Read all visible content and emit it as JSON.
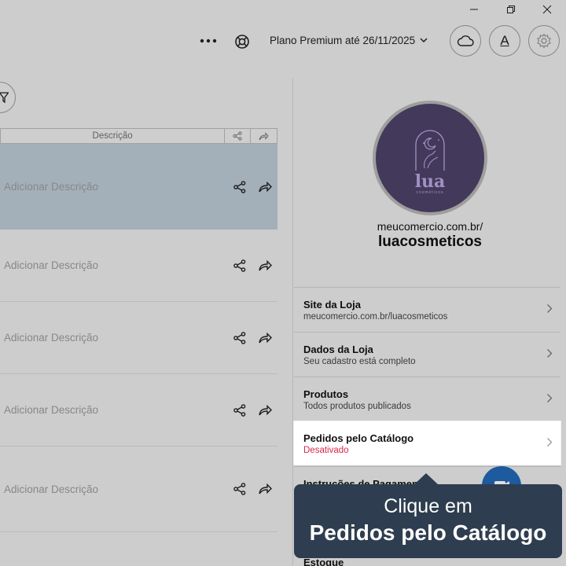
{
  "window": {
    "minimize_icon": "minimize-icon",
    "maximize_icon": "restore-icon",
    "close_icon": "close-icon"
  },
  "header": {
    "plan_label": "Plano Premium até 26/11/2025",
    "font_button_label": "A"
  },
  "table": {
    "header_description": "Descrição",
    "rows": [
      {
        "description": "Adicionar Descrição",
        "selected": true
      },
      {
        "description": "Adicionar Descrição",
        "selected": false
      },
      {
        "description": "Adicionar Descrição",
        "selected": false
      },
      {
        "description": "Adicionar Descrição",
        "selected": false
      },
      {
        "description": "Adicionar Descrição",
        "selected": false
      }
    ]
  },
  "store": {
    "logo_text": "lua",
    "logo_subtext": "cosméticos",
    "domain": "meucomercio.com.br/",
    "name": "luacosmeticos"
  },
  "menu": [
    {
      "title": "Site da Loja",
      "subtitle": "meucomercio.com.br/luacosmeticos"
    },
    {
      "title": "Dados da Loja",
      "subtitle": "Seu cadastro está completo"
    },
    {
      "title": "Produtos",
      "subtitle": "Todos produtos publicados"
    },
    {
      "title": "Pedidos pelo Catálogo",
      "subtitle": "Desativado"
    },
    {
      "title": "Instruções de Pagamento",
      "subtitle": ""
    },
    {
      "title": "Estoque",
      "subtitle": ""
    }
  ],
  "tooltip": {
    "line1": "Clique em",
    "line2": "Pedidos pelo Catálogo"
  },
  "colors": {
    "selected_row": "#bccbd6",
    "tooltip_bg": "#2e3d4f",
    "logo_bg": "#4e4268",
    "status_red": "#d8284a",
    "fab_blue": "#2268b6"
  }
}
